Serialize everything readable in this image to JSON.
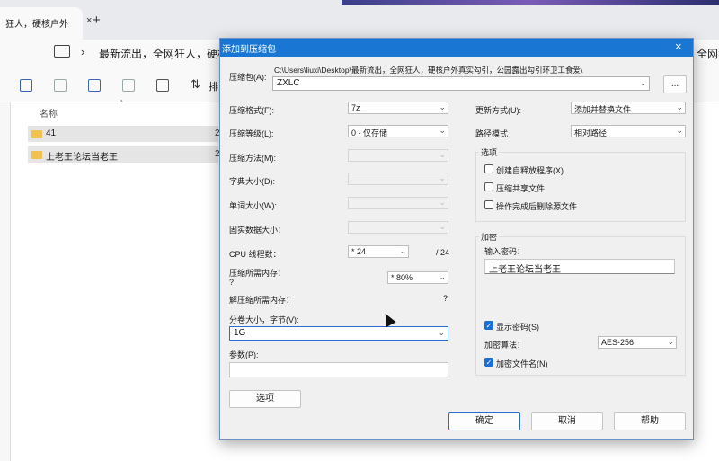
{
  "explorer": {
    "tab_title": "狂人，硬核户外",
    "tab_close": "×",
    "tab_add": "+",
    "address": "最新流出，全网狂人，硬核",
    "address_right": "全网狂",
    "toolbar_sort_label": "排",
    "column_name": "名称",
    "files": [
      {
        "name": "41",
        "trail": "2"
      },
      {
        "name": "上老王论坛当老王",
        "trail": "2"
      }
    ]
  },
  "dialog": {
    "title": "添加到压缩包",
    "close": "×",
    "archive_label": "压缩包(A):",
    "archive_path": "C:\\Users\\liuxi\\Desktop\\最新流出，全网狂人，硬核户外真实勾引，公园露出勾引环卫工食爱\\",
    "archive_name": "ZXLC",
    "browse": "...",
    "format_label": "压缩格式(F):",
    "format_value": "7z",
    "level_label": "压缩等级(L):",
    "level_value": "0 - 仅存储",
    "method_label": "压缩方法(M):",
    "dict_label": "字典大小(D):",
    "word_label": "单词大小(W):",
    "solid_label": "固实数据大小：",
    "cpu_label": "CPU 线程数：",
    "cpu_value": "* 24",
    "cpu_total": "/ 24",
    "mem_comp_label": "压缩所需内存：",
    "mem_comp_q": "?",
    "mem_comp_value": "* 80%",
    "mem_decomp_label": "解压缩所需内存：",
    "mem_decomp_q": "?",
    "split_label": "分卷大小，字节(V):",
    "split_value": "1G",
    "params_label": "参数(P):",
    "options_button": "选项",
    "update_label": "更新方式(U):",
    "update_value": "添加并替换文件",
    "path_label": "路径模式",
    "path_value": "相对路径",
    "options_group": "选项",
    "opt_sfx": "创建自释放程序(X)",
    "opt_shared": "压缩共享文件",
    "opt_delete": "操作完成后删除源文件",
    "encrypt_group": "加密",
    "password_label": "输入密码：",
    "password_value": "上老王论坛当老王",
    "show_password": "显示密码(S)",
    "enc_method_label": "加密算法：",
    "enc_method_value": "AES-256",
    "enc_names": "加密文件名(N)",
    "ok": "确定",
    "cancel": "取消",
    "help": "帮助"
  }
}
